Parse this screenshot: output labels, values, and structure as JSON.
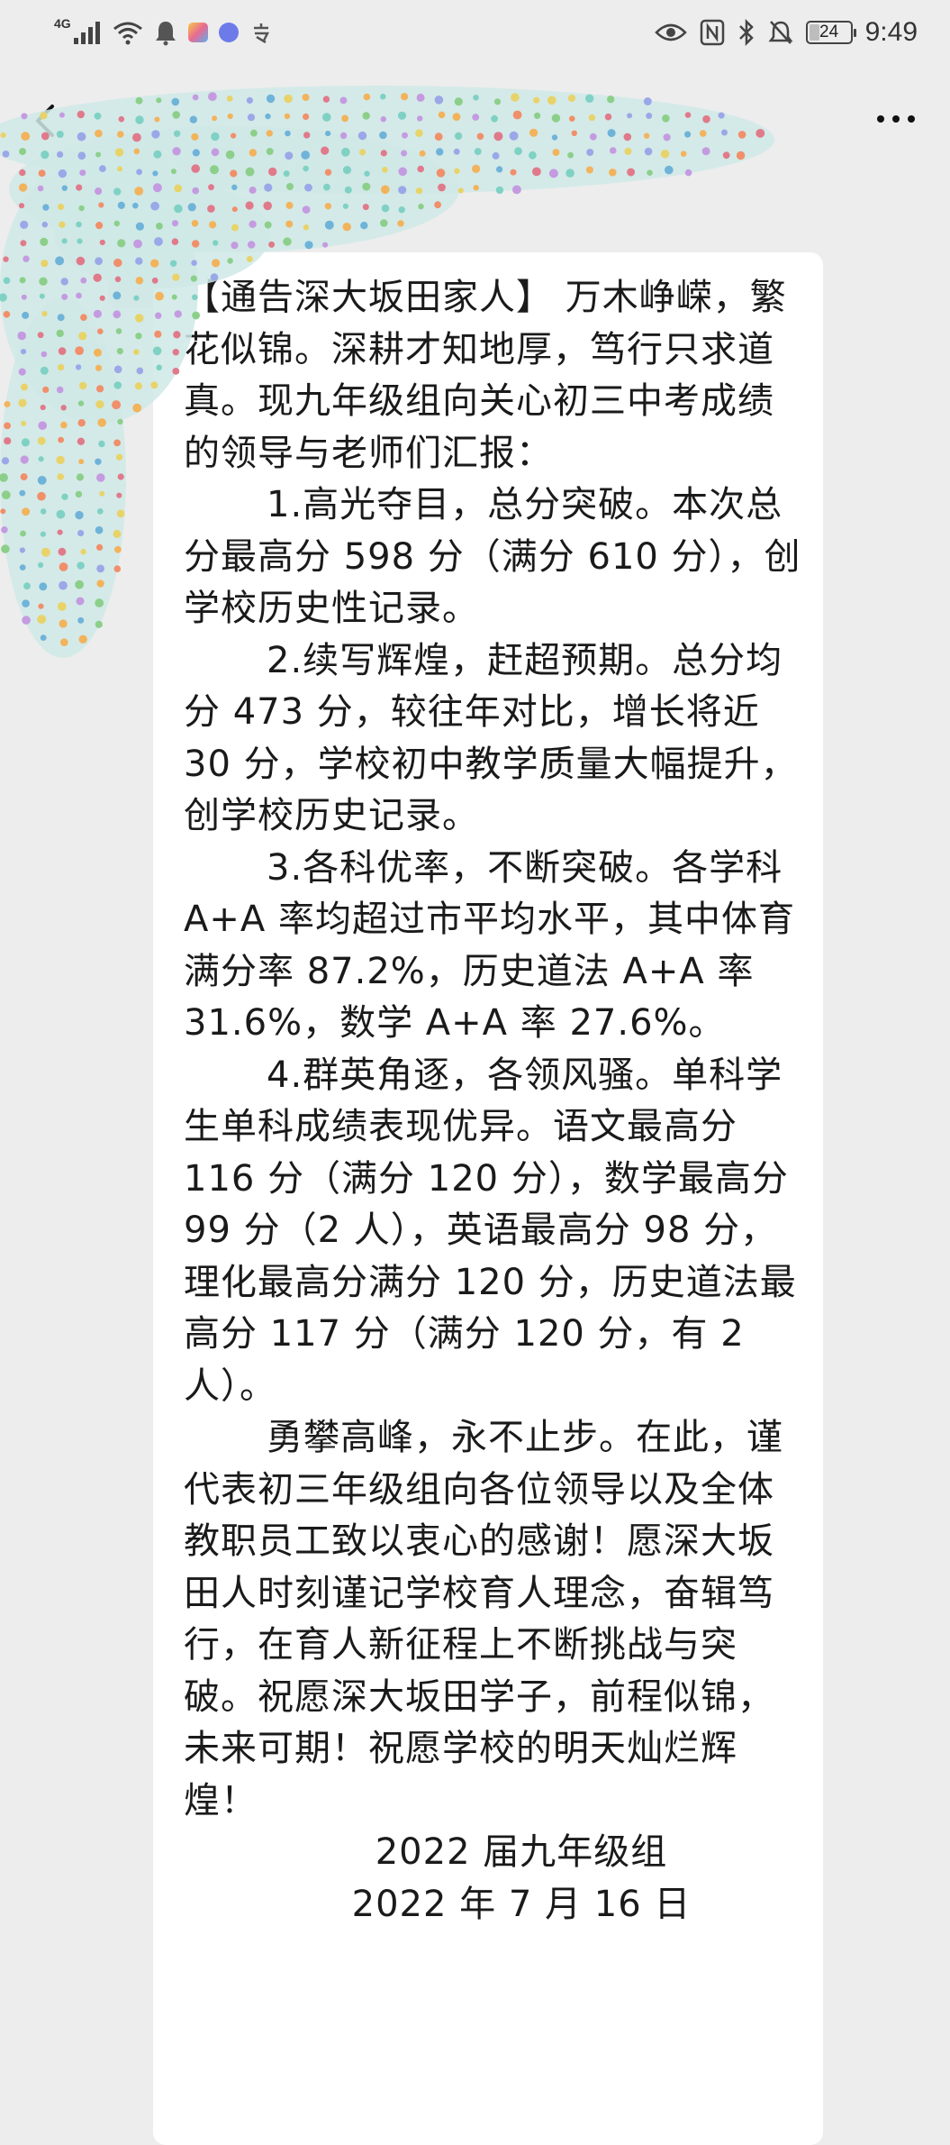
{
  "status_bar": {
    "network": "4G",
    "battery_level": "24",
    "battery_fraction": 0.24,
    "time": "9:49",
    "left_icons": [
      "signal-icon",
      "wifi-icon",
      "notification-bell-icon",
      "app-icon-colorful",
      "app-icon-blue",
      "app-icon-misc"
    ],
    "right_icons": [
      "eye-icon",
      "nfc-icon",
      "bluetooth-icon",
      "mute-icon",
      "battery-icon"
    ]
  },
  "title_bar": {
    "back_icon": "chevron-left-icon",
    "more_icon": "more-dots-icon"
  },
  "message": {
    "paragraphs": [
      {
        "indent": false,
        "text": "【通告深大坂田家人】 万木峥嵘，繁花似锦。深耕才知地厚，笃行只求道真。现九年级组向关心初三中考成绩的领导与老师们汇报："
      },
      {
        "indent": true,
        "text": "1.高光夺目，总分突破。本次总分最高分 598 分（满分 610 分），创学校历史性记录。"
      },
      {
        "indent": true,
        "text": "2.续写辉煌，赶超预期。总分均分 473 分，较往年对比，增长将近 30 分，学校初中教学质量大幅提升，创学校历史记录。"
      },
      {
        "indent": true,
        "text": "3.各科优率，不断突破。各学科 A+A 率均超过市平均水平，其中体育满分率 87.2%，历史道法 A+A 率 31.6%，数学 A+A 率 27.6%。"
      },
      {
        "indent": true,
        "text": "4.群英角逐，各领风骚。单科学生单科成绩表现优异。语文最高分 116 分（满分 120 分），数学最高分 99 分（2 人），英语最高分 98 分，理化最高分满分 120 分，历史道法最高分 117 分（满分 120 分，有 2 人）。"
      },
      {
        "indent": true,
        "text": "勇攀高峰，永不止步。在此，谨代表初三年级组向各位领导以及全体教职员工致以衷心的感谢！愿深大坂田人时刻谨记学校育人理念，奋辑笃行，在育人新征程上不断挑战与突破。祝愿深大坂田学子，前程似锦，未来可期！祝愿学校的明天灿烂辉煌！"
      }
    ],
    "signature": "2022 届九年级组",
    "date": "2022 年 7 月 16 日"
  },
  "colors": {
    "background": "#ededed",
    "bubble": "#ffffff",
    "text": "#1a1a1a"
  }
}
